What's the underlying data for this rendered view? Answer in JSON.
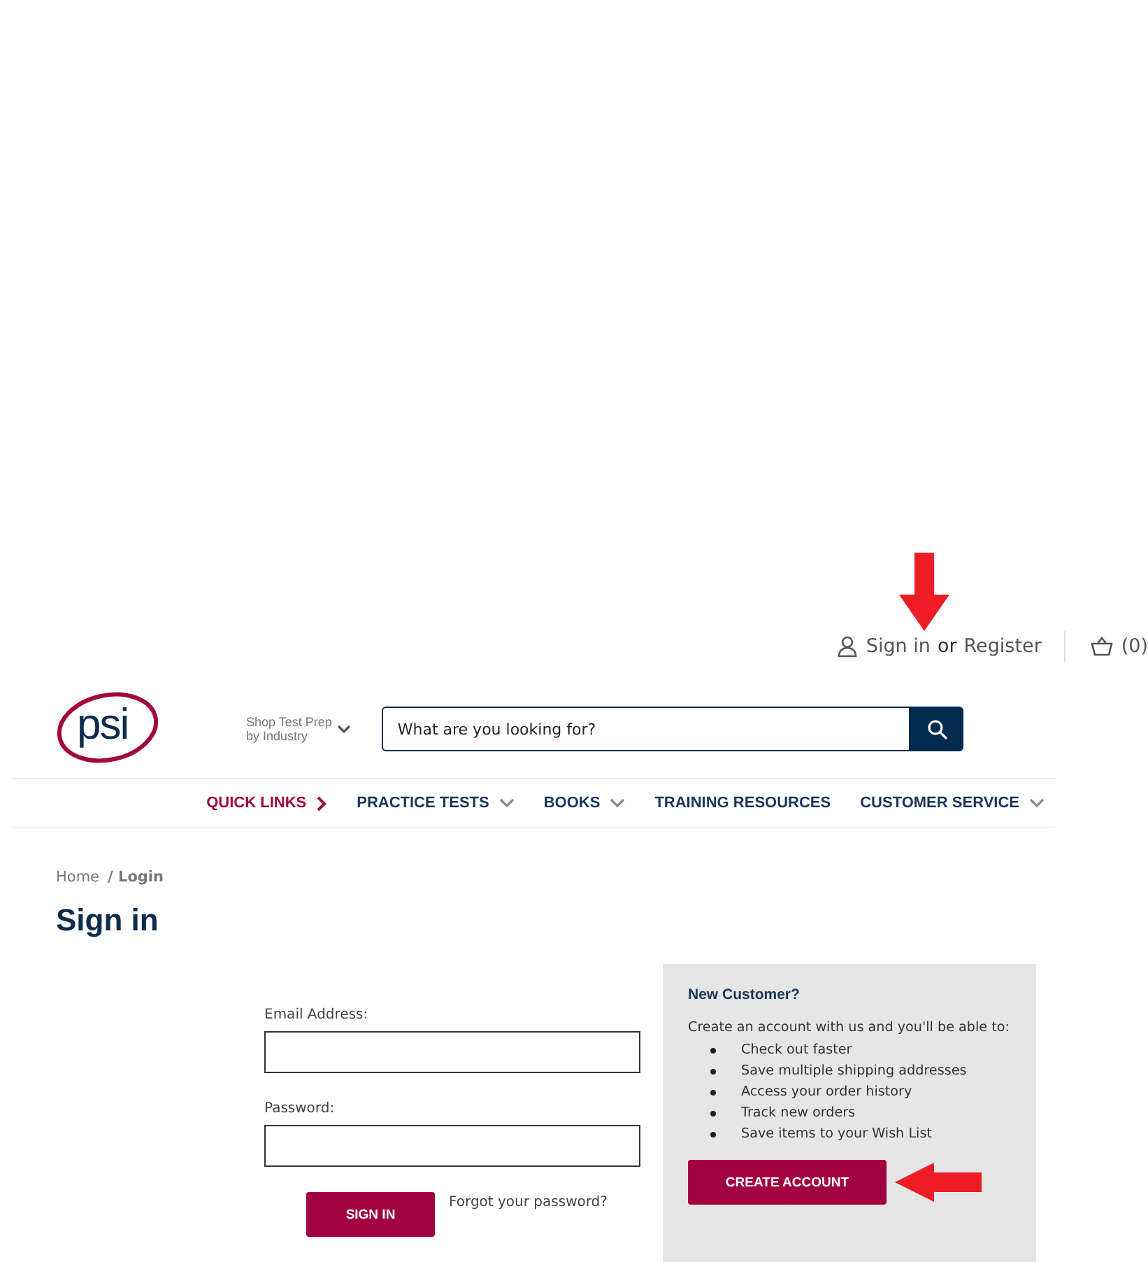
{
  "top_bar": {
    "sign_in": "Sign in",
    "or": "or",
    "register": "Register",
    "cart_count": "(0)"
  },
  "header": {
    "logo": "psi",
    "industry_menu": [
      "Shop Test Prep",
      "by Industry"
    ],
    "search": {
      "placeholder": "What are you looking for?"
    }
  },
  "nav": [
    {
      "label": "QUICK LINKS",
      "highlighted": true,
      "kind": "link"
    },
    {
      "label": "PRACTICE TESTS",
      "highlighted": false,
      "kind": "menu"
    },
    {
      "label": "BOOKS",
      "highlighted": false,
      "kind": "menu"
    },
    {
      "label": "TRAINING RESOURCES",
      "highlighted": false,
      "kind": "plain"
    },
    {
      "label": "CUSTOMER SERVICE",
      "highlighted": false,
      "kind": "menu"
    }
  ],
  "breadcrumb": [
    "Home",
    "/ Login"
  ],
  "title": "Sign in",
  "form": {
    "email_label": "Email Address:",
    "password_label": "Password:",
    "submit": "SIGN IN",
    "forgot": "Forgot your password?"
  },
  "new_customer": {
    "heading": "New Customer?",
    "intro": "Create an account with us and you'll be able to:",
    "benefits": [
      "Check out faster",
      "Save multiple shipping addresses",
      "Access your order history",
      "Track new orders",
      "Save items to your Wish List"
    ],
    "button": "CREATE ACCOUNT"
  }
}
